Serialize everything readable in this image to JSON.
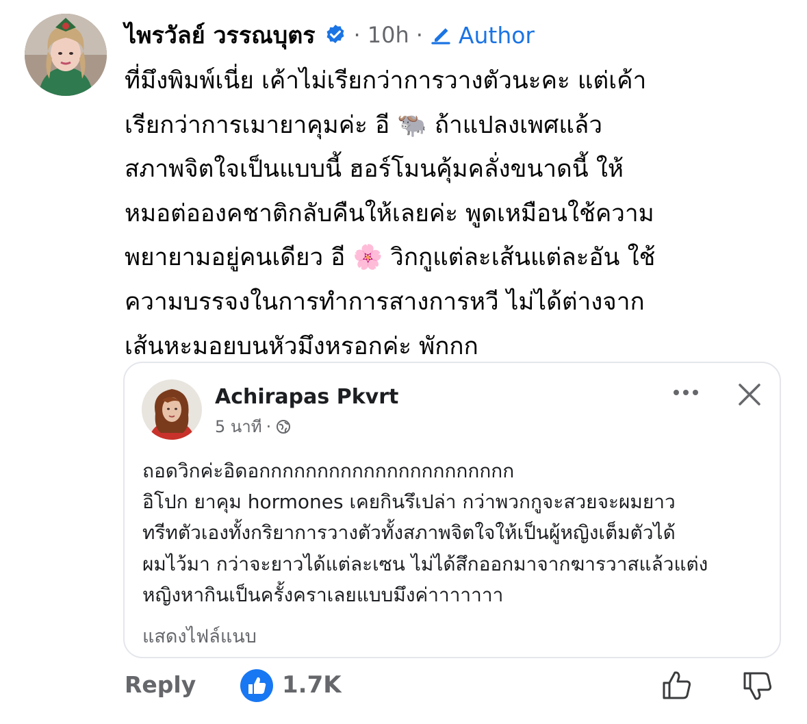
{
  "comment": {
    "author": "ไพรวัลย์ วรรณบุตร",
    "time": "10h",
    "separator": "·",
    "badge_label": "Author",
    "lines": [
      "ที่มึงพิมพ์เนี่ย เค้าไม่เรียกว่าการวางตัวนะคะ  แต่เค้า",
      "เรียกว่าการเมายาคุมค่ะ อี 🐃  ถ้าแปลงเพศแล้ว",
      "สภาพจิตใจเป็นแบบนี้ ฮอร์โมนคุ้มคลั่งขนาดนี้  ให้",
      "หมอต่อองคชาติกลับคืนให้เลยค่ะ พูดเหมือนใช้ความ",
      "พยายามอยู่คนเดียว อี 🌸 วิกกูแต่ละเส้นแต่ละอัน ใช้",
      "ความบรรจงในการทำการสางการหวี ไม่ได้ต่างจาก",
      "เส้นหะมอยบนหัวมึงหรอกค่ะ พักกก"
    ]
  },
  "quoted_post": {
    "author": "Achirapas Pkvrt",
    "time": "5 นาที",
    "separator": "·",
    "lines": [
      "ถอดวิกค่ะอิดอกกกกกกกกกกกกกกกกกกกกกก",
      "อิโปก ยาคุม hormones เคยกินรึเปล่า กว่าพวกกูจะสวยจะผมยาว",
      "ทรีทตัวเองทั้งกริยาการวางตัวทั้งสภาพจิตใจให้เป็นผู้หญิงเต็มตัวได้",
      "ผมไว้มา กว่าจะยาวได้แต่ละเซน ไม่ได้สึกออกมาจากฆารวาสแล้วแต่ง",
      "หญิงหากินเป็นครั้งคราเลยแบบมึงค่าาาาาาา"
    ],
    "attachment_label": "แสดงไฟล์แนบ"
  },
  "actions": {
    "reply_label": "Reply",
    "like_count": "1.7K"
  },
  "colors": {
    "accent": "#1b74e4",
    "secondary_text": "#65676b",
    "like_blue": "#1877f2"
  }
}
